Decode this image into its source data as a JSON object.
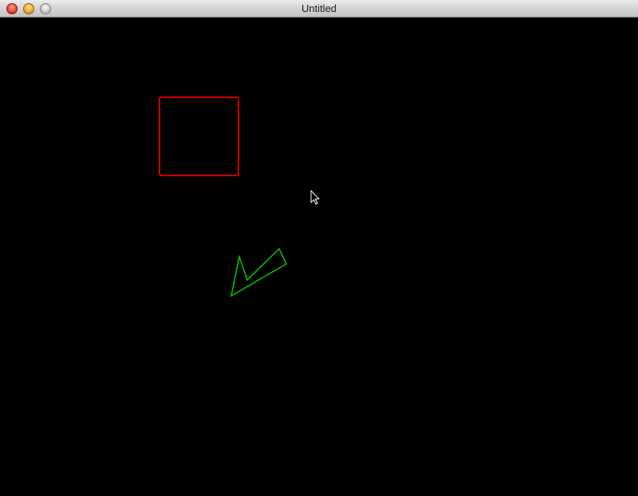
{
  "window": {
    "title": "Untitled",
    "buttons": {
      "close": "close-button",
      "minimize": "minimize-button",
      "zoom": "zoom-button"
    }
  },
  "canvas": {
    "background": "#000000",
    "shapes": [
      {
        "kind": "square-outline",
        "stroke": "#cc0000"
      },
      {
        "kind": "arrowhead-outline",
        "stroke": "#00cc00"
      }
    ],
    "cursor": "arrow-pointer-icon"
  }
}
